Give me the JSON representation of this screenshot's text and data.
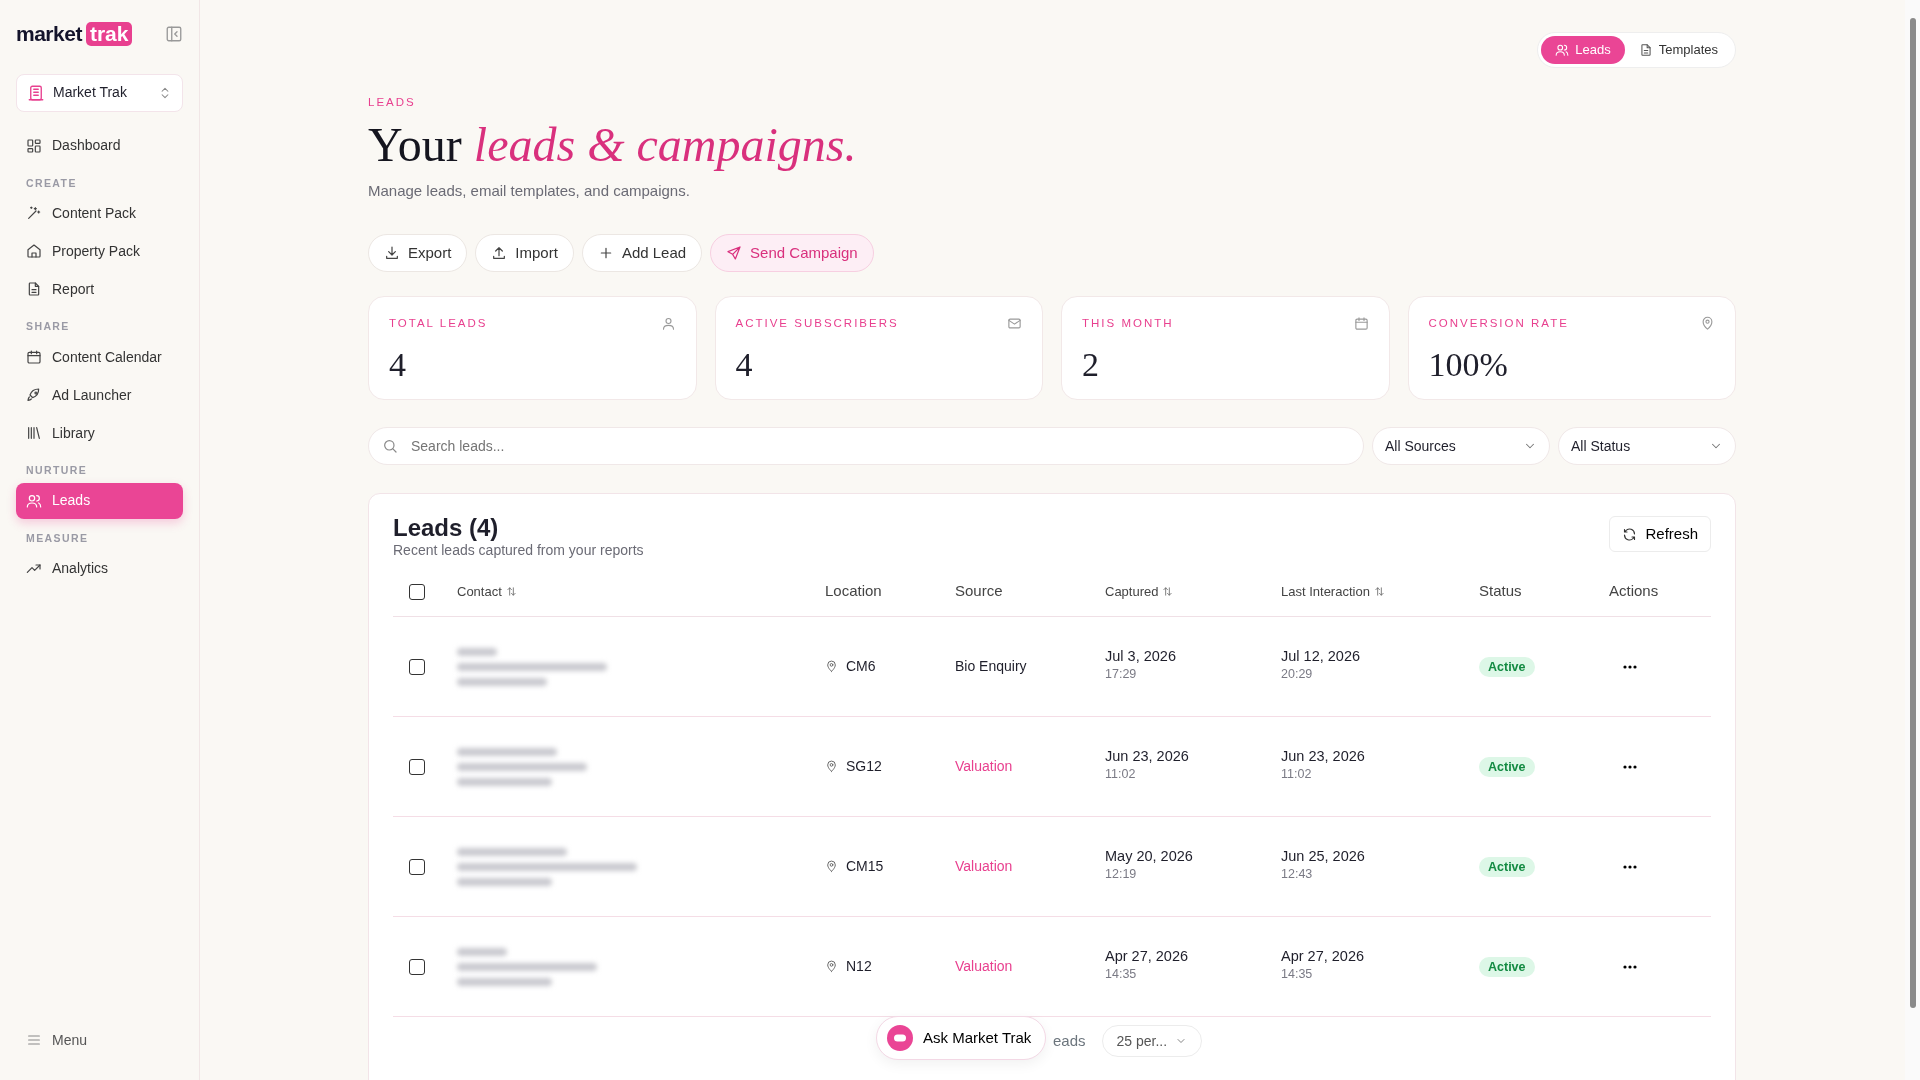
{
  "sidebar": {
    "logo": {
      "word": "market",
      "badge": "trak"
    },
    "workspace": "Market Trak",
    "sections": [
      {
        "items": [
          {
            "label": "Dashboard",
            "selected": false
          }
        ]
      },
      {
        "heading": "CREATE",
        "items": [
          {
            "label": "Content Pack",
            "selected": false
          },
          {
            "label": "Property Pack",
            "selected": false
          },
          {
            "label": "Report",
            "selected": false
          }
        ]
      },
      {
        "heading": "SHARE",
        "items": [
          {
            "label": "Content Calendar",
            "selected": false
          },
          {
            "label": "Ad Launcher",
            "selected": false
          },
          {
            "label": "Library",
            "selected": false
          }
        ]
      },
      {
        "heading": "NURTURE",
        "items": [
          {
            "label": "Leads",
            "selected": true
          }
        ]
      },
      {
        "heading": "MEASURE",
        "items": [
          {
            "label": "Analytics",
            "selected": false
          }
        ]
      }
    ],
    "menu": "Menu"
  },
  "view_toggle": [
    {
      "label": "Leads",
      "selected": true
    },
    {
      "label": "Templates",
      "selected": false
    }
  ],
  "header": {
    "eyebrow": "LEADS",
    "title_plain": "Your",
    "title_accent": "leads & campaigns.",
    "subtitle": "Manage leads, email templates, and campaigns."
  },
  "actions": [
    {
      "label": "Export",
      "primary": false
    },
    {
      "label": "Import",
      "primary": false
    },
    {
      "label": "Add Lead",
      "primary": false
    },
    {
      "label": "Send Campaign",
      "primary": true
    }
  ],
  "stats": [
    {
      "label": "TOTAL LEADS",
      "value": "4"
    },
    {
      "label": "ACTIVE SUBSCRIBERS",
      "value": "4"
    },
    {
      "label": "THIS MONTH",
      "value": "2"
    },
    {
      "label": "CONVERSION RATE",
      "value": "100%"
    }
  ],
  "filters": {
    "search_placeholder": "Search leads...",
    "source": "All Sources",
    "status": "All Status"
  },
  "leads_table": {
    "title": "Leads (4)",
    "subtitle": "Recent leads captured from your reports",
    "refresh": "Refresh",
    "select_all_checked": false,
    "columns": [
      {
        "label": "Contact",
        "sortable": true
      },
      {
        "label": "Location",
        "sortable": false
      },
      {
        "label": "Source",
        "sortable": false
      },
      {
        "label": "Captured",
        "sortable": true
      },
      {
        "label": "Last Interaction",
        "sortable": true
      },
      {
        "label": "Status",
        "sortable": false
      },
      {
        "label": "Actions",
        "sortable": false
      }
    ],
    "rows": [
      {
        "checked": false,
        "location": "CM6",
        "source": "Bio Enquiry",
        "source_highlighted": false,
        "captured_date": "Jul 3, 2026",
        "captured_time": "17:29",
        "last_date": "Jul 12, 2026",
        "last_time": "20:29",
        "status": "Active"
      },
      {
        "checked": false,
        "location": "SG12",
        "source": "Valuation",
        "source_highlighted": true,
        "captured_date": "Jun 23, 2026",
        "captured_time": "11:02",
        "last_date": "Jun 23, 2026",
        "last_time": "11:02",
        "status": "Active"
      },
      {
        "checked": false,
        "location": "CM15",
        "source": "Valuation",
        "source_highlighted": true,
        "captured_date": "May 20, 2026",
        "captured_time": "12:19",
        "last_date": "Jun 25, 2026",
        "last_time": "12:43",
        "status": "Active"
      },
      {
        "checked": false,
        "location": "N12",
        "source": "Valuation",
        "source_highlighted": true,
        "captured_date": "Apr 27, 2026",
        "captured_time": "14:35",
        "last_date": "Apr 27, 2026",
        "last_time": "14:35",
        "status": "Active"
      }
    ],
    "footer_text": "eads",
    "per_page": "25 per..."
  },
  "assistant": {
    "label": "Ask Market Trak"
  }
}
